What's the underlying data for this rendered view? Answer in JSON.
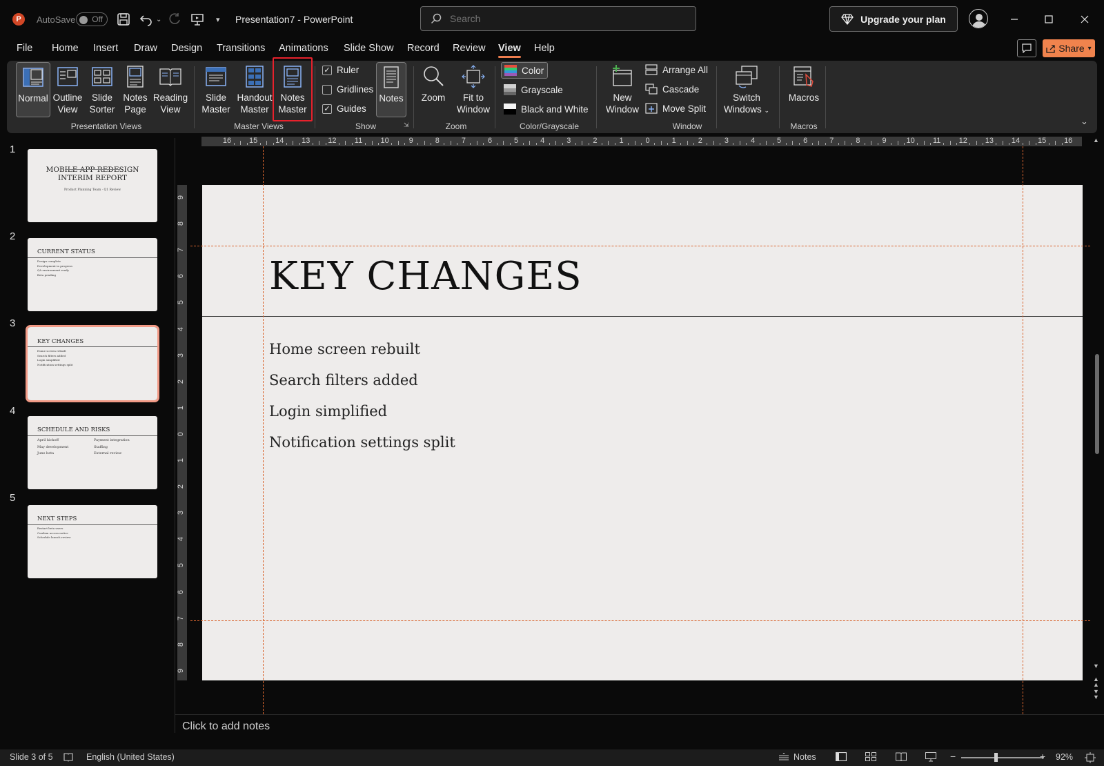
{
  "titlebar": {
    "autosave_label": "AutoSave",
    "autosave_state": "Off",
    "doc_title": "Presentation7  -  PowerPoint",
    "search_placeholder": "Search",
    "upgrade_label": "Upgrade your plan"
  },
  "menu": {
    "tabs": [
      "File",
      "Home",
      "Insert",
      "Draw",
      "Design",
      "Transitions",
      "Animations",
      "Slide Show",
      "Record",
      "Review",
      "View",
      "Help"
    ],
    "active_tab": "View",
    "share_label": "Share"
  },
  "ribbon": {
    "presentation_views": {
      "label": "Presentation Views",
      "buttons": [
        {
          "line1": "Normal",
          "line2": ""
        },
        {
          "line1": "Outline",
          "line2": "View"
        },
        {
          "line1": "Slide",
          "line2": "Sorter"
        },
        {
          "line1": "Notes",
          "line2": "Page"
        },
        {
          "line1": "Reading",
          "line2": "View"
        }
      ]
    },
    "master_views": {
      "label": "Master Views",
      "buttons": [
        {
          "line1": "Slide",
          "line2": "Master"
        },
        {
          "line1": "Handout",
          "line2": "Master"
        },
        {
          "line1": "Notes",
          "line2": "Master"
        }
      ]
    },
    "show": {
      "label": "Show",
      "ruler": "Ruler",
      "gridlines": "Gridlines",
      "guides": "Guides",
      "ruler_checked": true,
      "gridlines_checked": false,
      "guides_checked": true,
      "notes": "Notes"
    },
    "zoom": {
      "label": "Zoom",
      "zoom_btn": "Zoom",
      "fit_line1": "Fit to",
      "fit_line2": "Window"
    },
    "color": {
      "label": "Color/Grayscale",
      "color": "Color",
      "grayscale": "Grayscale",
      "bw": "Black and White"
    },
    "window": {
      "label": "Window",
      "new_line1": "New",
      "new_line2": "Window",
      "arrange": "Arrange All",
      "cascade": "Cascade",
      "move_split": "Move Split",
      "switch_line1": "Switch",
      "switch_line2": "Windows"
    },
    "macros": {
      "label": "Macros",
      "button": "Macros"
    }
  },
  "thumbnails": [
    {
      "num": "1",
      "title": "MOBILE APP REDESIGN INTERIM REPORT",
      "subtitle": "Product Planning Team · Q1 Review"
    },
    {
      "num": "2",
      "title": "CURRENT STATUS",
      "lines": [
        "Design complete",
        "Development in progress",
        "QA environment ready",
        "Beta pending"
      ]
    },
    {
      "num": "3",
      "title": "KEY CHANGES",
      "lines": [
        "Home screen rebuilt",
        "Search filters added",
        "Login simplified",
        "Notification settings split"
      ]
    },
    {
      "num": "4",
      "title": "SCHEDULE AND RISKS",
      "left": [
        "April kickoff",
        "May development",
        "June beta"
      ],
      "right": [
        "Payment integration",
        "Staffing",
        "External review"
      ]
    },
    {
      "num": "5",
      "title": "NEXT STEPS",
      "lines": [
        "Restart beta users",
        "Confirm access notice",
        "Schedule launch review"
      ]
    }
  ],
  "slide": {
    "title": "KEY CHANGES",
    "bullets": [
      "Home screen rebuilt",
      "Search filters added",
      "Login simplified",
      "Notification settings split"
    ]
  },
  "ruler": {
    "h": [
      "16",
      "15",
      "14",
      "13",
      "12",
      "11",
      "10",
      "9",
      "8",
      "7",
      "6",
      "5",
      "4",
      "3",
      "2",
      "1",
      "0",
      "1",
      "2",
      "3",
      "4",
      "5",
      "6",
      "7",
      "8",
      "9",
      "10",
      "11",
      "12",
      "13",
      "14",
      "15",
      "16"
    ],
    "v": [
      "9",
      "8",
      "7",
      "6",
      "5",
      "4",
      "3",
      "2",
      "1",
      "0",
      "1",
      "2",
      "3",
      "4",
      "5",
      "6",
      "7",
      "8",
      "9"
    ]
  },
  "notes": {
    "placeholder": "Click to add notes"
  },
  "statusbar": {
    "slide_info": "Slide 3 of 5",
    "language": "English (United States)",
    "notes": "Notes",
    "zoom": "92%"
  }
}
